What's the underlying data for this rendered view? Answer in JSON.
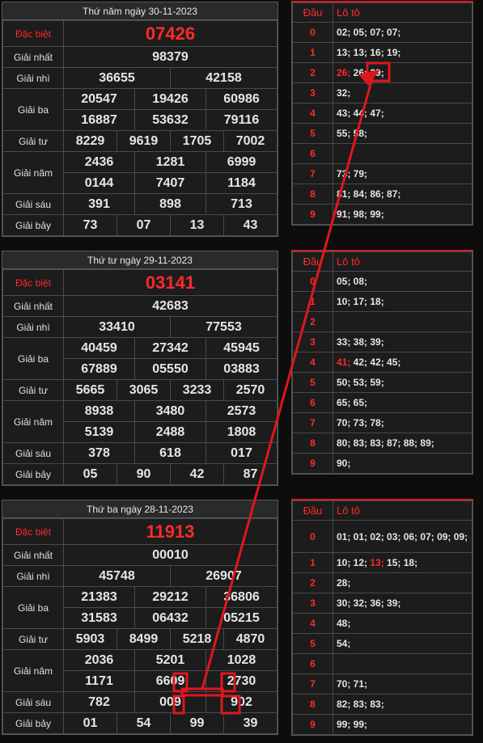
{
  "blocks": [
    {
      "date": "Thứ năm ngày 30-11-2023",
      "labels": {
        "db": "Đặc biệt",
        "g1": "Giải nhất",
        "g2": "Giải nhì",
        "g3": "Giải ba",
        "g4": "Giải tư",
        "g5": "Giải năm",
        "g6": "Giải sáu",
        "g7": "Giải bảy"
      },
      "db": "07426",
      "g1": "98379",
      "g2": [
        "36655",
        "42158"
      ],
      "g3": [
        "20547",
        "19426",
        "60986",
        "16887",
        "53632",
        "79116"
      ],
      "g4": [
        "8229",
        "9619",
        "1705",
        "7002"
      ],
      "g5": [
        "2436",
        "1281",
        "6999",
        "0144",
        "7407",
        "1184"
      ],
      "g6": [
        "391",
        "898",
        "713"
      ],
      "g7": [
        "73",
        "07",
        "13",
        "43"
      ],
      "loto_head": {
        "dau": "Đầu",
        "loto": "Lô tô"
      },
      "loto": [
        {
          "d": "0",
          "v": "02; 05; 07; 07;"
        },
        {
          "d": "1",
          "v": "13; 13; 16; 19;"
        },
        {
          "d": "2",
          "hi": "26;",
          "v": " 26; 29;"
        },
        {
          "d": "3",
          "v": "32;"
        },
        {
          "d": "4",
          "v": "43; 44; 47;"
        },
        {
          "d": "5",
          "v": "55; 58;"
        },
        {
          "d": "6",
          "v": ""
        },
        {
          "d": "7",
          "v": "73; 79;"
        },
        {
          "d": "8",
          "v": "81; 84; 86; 87;"
        },
        {
          "d": "9",
          "v": "91; 98; 99;"
        }
      ]
    },
    {
      "date": "Thứ tư ngày 29-11-2023",
      "labels": {
        "db": "Đặc biệt",
        "g1": "Giải nhất",
        "g2": "Giải nhì",
        "g3": "Giải ba",
        "g4": "Giải tư",
        "g5": "Giải năm",
        "g6": "Giải sáu",
        "g7": "Giải bảy"
      },
      "db": "03141",
      "g1": "42683",
      "g2": [
        "33410",
        "77553"
      ],
      "g3": [
        "40459",
        "27342",
        "45945",
        "67889",
        "05550",
        "03883"
      ],
      "g4": [
        "5665",
        "3065",
        "3233",
        "2570"
      ],
      "g5": [
        "8938",
        "3480",
        "2573",
        "5139",
        "2488",
        "1808"
      ],
      "g6": [
        "378",
        "618",
        "017"
      ],
      "g7": [
        "05",
        "90",
        "42",
        "87"
      ],
      "loto_head": {
        "dau": "Đầu",
        "loto": "Lô tô"
      },
      "loto": [
        {
          "d": "0",
          "v": "05; 08;"
        },
        {
          "d": "1",
          "v": "10; 17; 18;"
        },
        {
          "d": "2",
          "v": ""
        },
        {
          "d": "3",
          "v": "33; 38; 39;"
        },
        {
          "d": "4",
          "hi": "41;",
          "v": " 42; 42; 45;"
        },
        {
          "d": "5",
          "v": "50; 53; 59;"
        },
        {
          "d": "6",
          "v": "65; 65;"
        },
        {
          "d": "7",
          "v": "70; 73; 78;"
        },
        {
          "d": "8",
          "v": "80; 83; 83; 87; 88; 89;"
        },
        {
          "d": "9",
          "v": "90;"
        }
      ]
    },
    {
      "date": "Thứ ba ngày 28-11-2023",
      "labels": {
        "db": "Đặc biệt",
        "g1": "Giải nhất",
        "g2": "Giải nhì",
        "g3": "Giải ba",
        "g4": "Giải tư",
        "g5": "Giải năm",
        "g6": "Giải sáu",
        "g7": "Giải bảy"
      },
      "db": "11913",
      "g1": "00010",
      "g2": [
        "45748",
        "26907"
      ],
      "g3": [
        "21383",
        "29212",
        "36806",
        "31583",
        "06432",
        "05215"
      ],
      "g4": [
        "5903",
        "8499",
        "5218",
        "4870"
      ],
      "g5": [
        "2036",
        "5201",
        "1028",
        "1171",
        "6609",
        "2730"
      ],
      "g6": [
        "782",
        "009",
        "902"
      ],
      "g7": [
        "01",
        "54",
        "99",
        "39"
      ],
      "loto_head": {
        "dau": "Đầu",
        "loto": "Lô tô"
      },
      "loto": [
        {
          "d": "0",
          "v": "01; 01; 02; 03; 06; 07; 09; 09;"
        },
        {
          "d": "1",
          "v": "10; 12; ",
          "hi2": "13;",
          "v2": " 15; 18;"
        },
        {
          "d": "2",
          "v": "28;"
        },
        {
          "d": "3",
          "v": "30; 32; 36; 39;"
        },
        {
          "d": "4",
          "v": "48;"
        },
        {
          "d": "5",
          "v": "54;"
        },
        {
          "d": "6",
          "v": ""
        },
        {
          "d": "7",
          "v": "70; 71;"
        },
        {
          "d": "8",
          "v": "82; 83; 83;"
        },
        {
          "d": "9",
          "v": "99; 99;"
        }
      ]
    }
  ],
  "annotation": {
    "color": "#e0161e"
  }
}
